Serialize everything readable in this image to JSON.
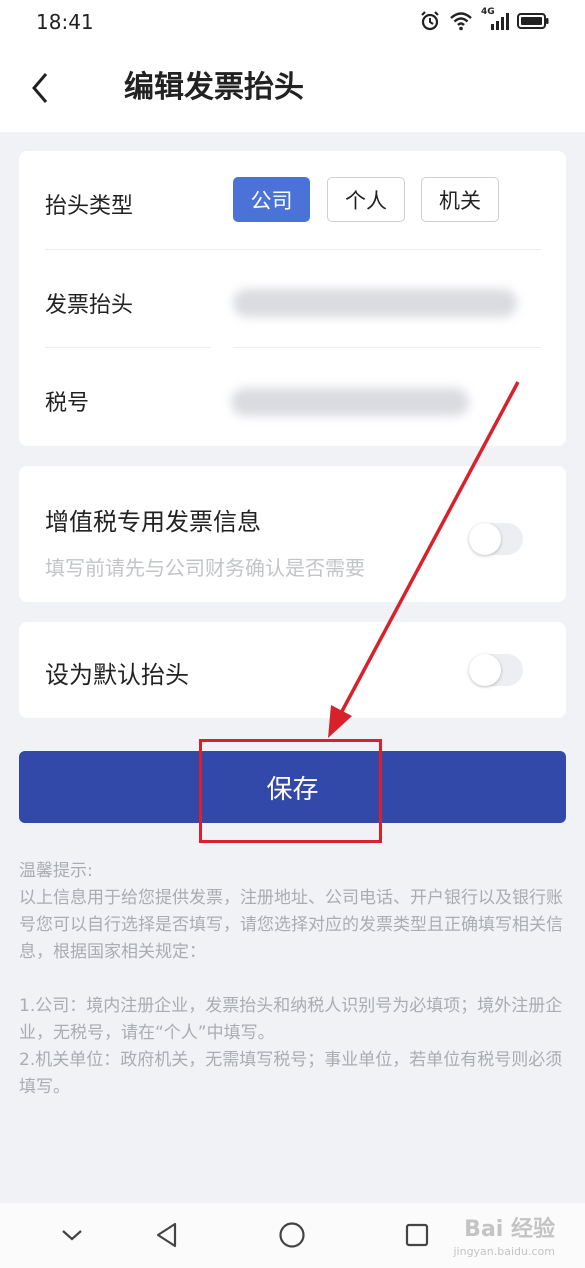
{
  "status_bar": {
    "time": "18:41",
    "network": "4G"
  },
  "header": {
    "title": "编辑发票抬头"
  },
  "form": {
    "type_label": "抬头类型",
    "type_options": [
      {
        "label": "公司",
        "selected": true
      },
      {
        "label": "个人",
        "selected": false
      },
      {
        "label": "机关",
        "selected": false
      }
    ],
    "title_label": "发票抬头",
    "tax_label": "税号"
  },
  "vat": {
    "title": "增值税专用发票信息",
    "subtitle": "填写前请先与公司财务确认是否需要",
    "enabled": false
  },
  "default_title": {
    "label": "设为默认抬头",
    "enabled": false
  },
  "save_button": {
    "label": "保存"
  },
  "tips": {
    "heading": "温馨提示:",
    "intro": "以上信息用于给您提供发票，注册地址、公司电话、开户银行以及银行账号您可以自行选择是否填写，请您选择对应的发票类型且正确填写相关信息，根据国家相关规定：",
    "rule1": "1.公司：境内注册企业，发票抬头和纳税人识别号为必填项；境外注册企业，无税号，请在“个人”中填写。",
    "rule2": "2.机关单位：政府机关，无需填写税号；事业单位，若单位有税号则必须填写。"
  },
  "watermark": {
    "line1": "Bai 经验",
    "line2": "jingyan.baidu.com"
  },
  "colors": {
    "primary": "#3349aa",
    "selected_chip": "#4b72d6",
    "annotation": "#d8212a"
  },
  "icons": [
    "alarm-icon",
    "wifi-icon",
    "signal-icon",
    "battery-icon",
    "back-icon",
    "chevron-down-icon",
    "nav-back-icon",
    "home-icon",
    "recents-icon"
  ]
}
